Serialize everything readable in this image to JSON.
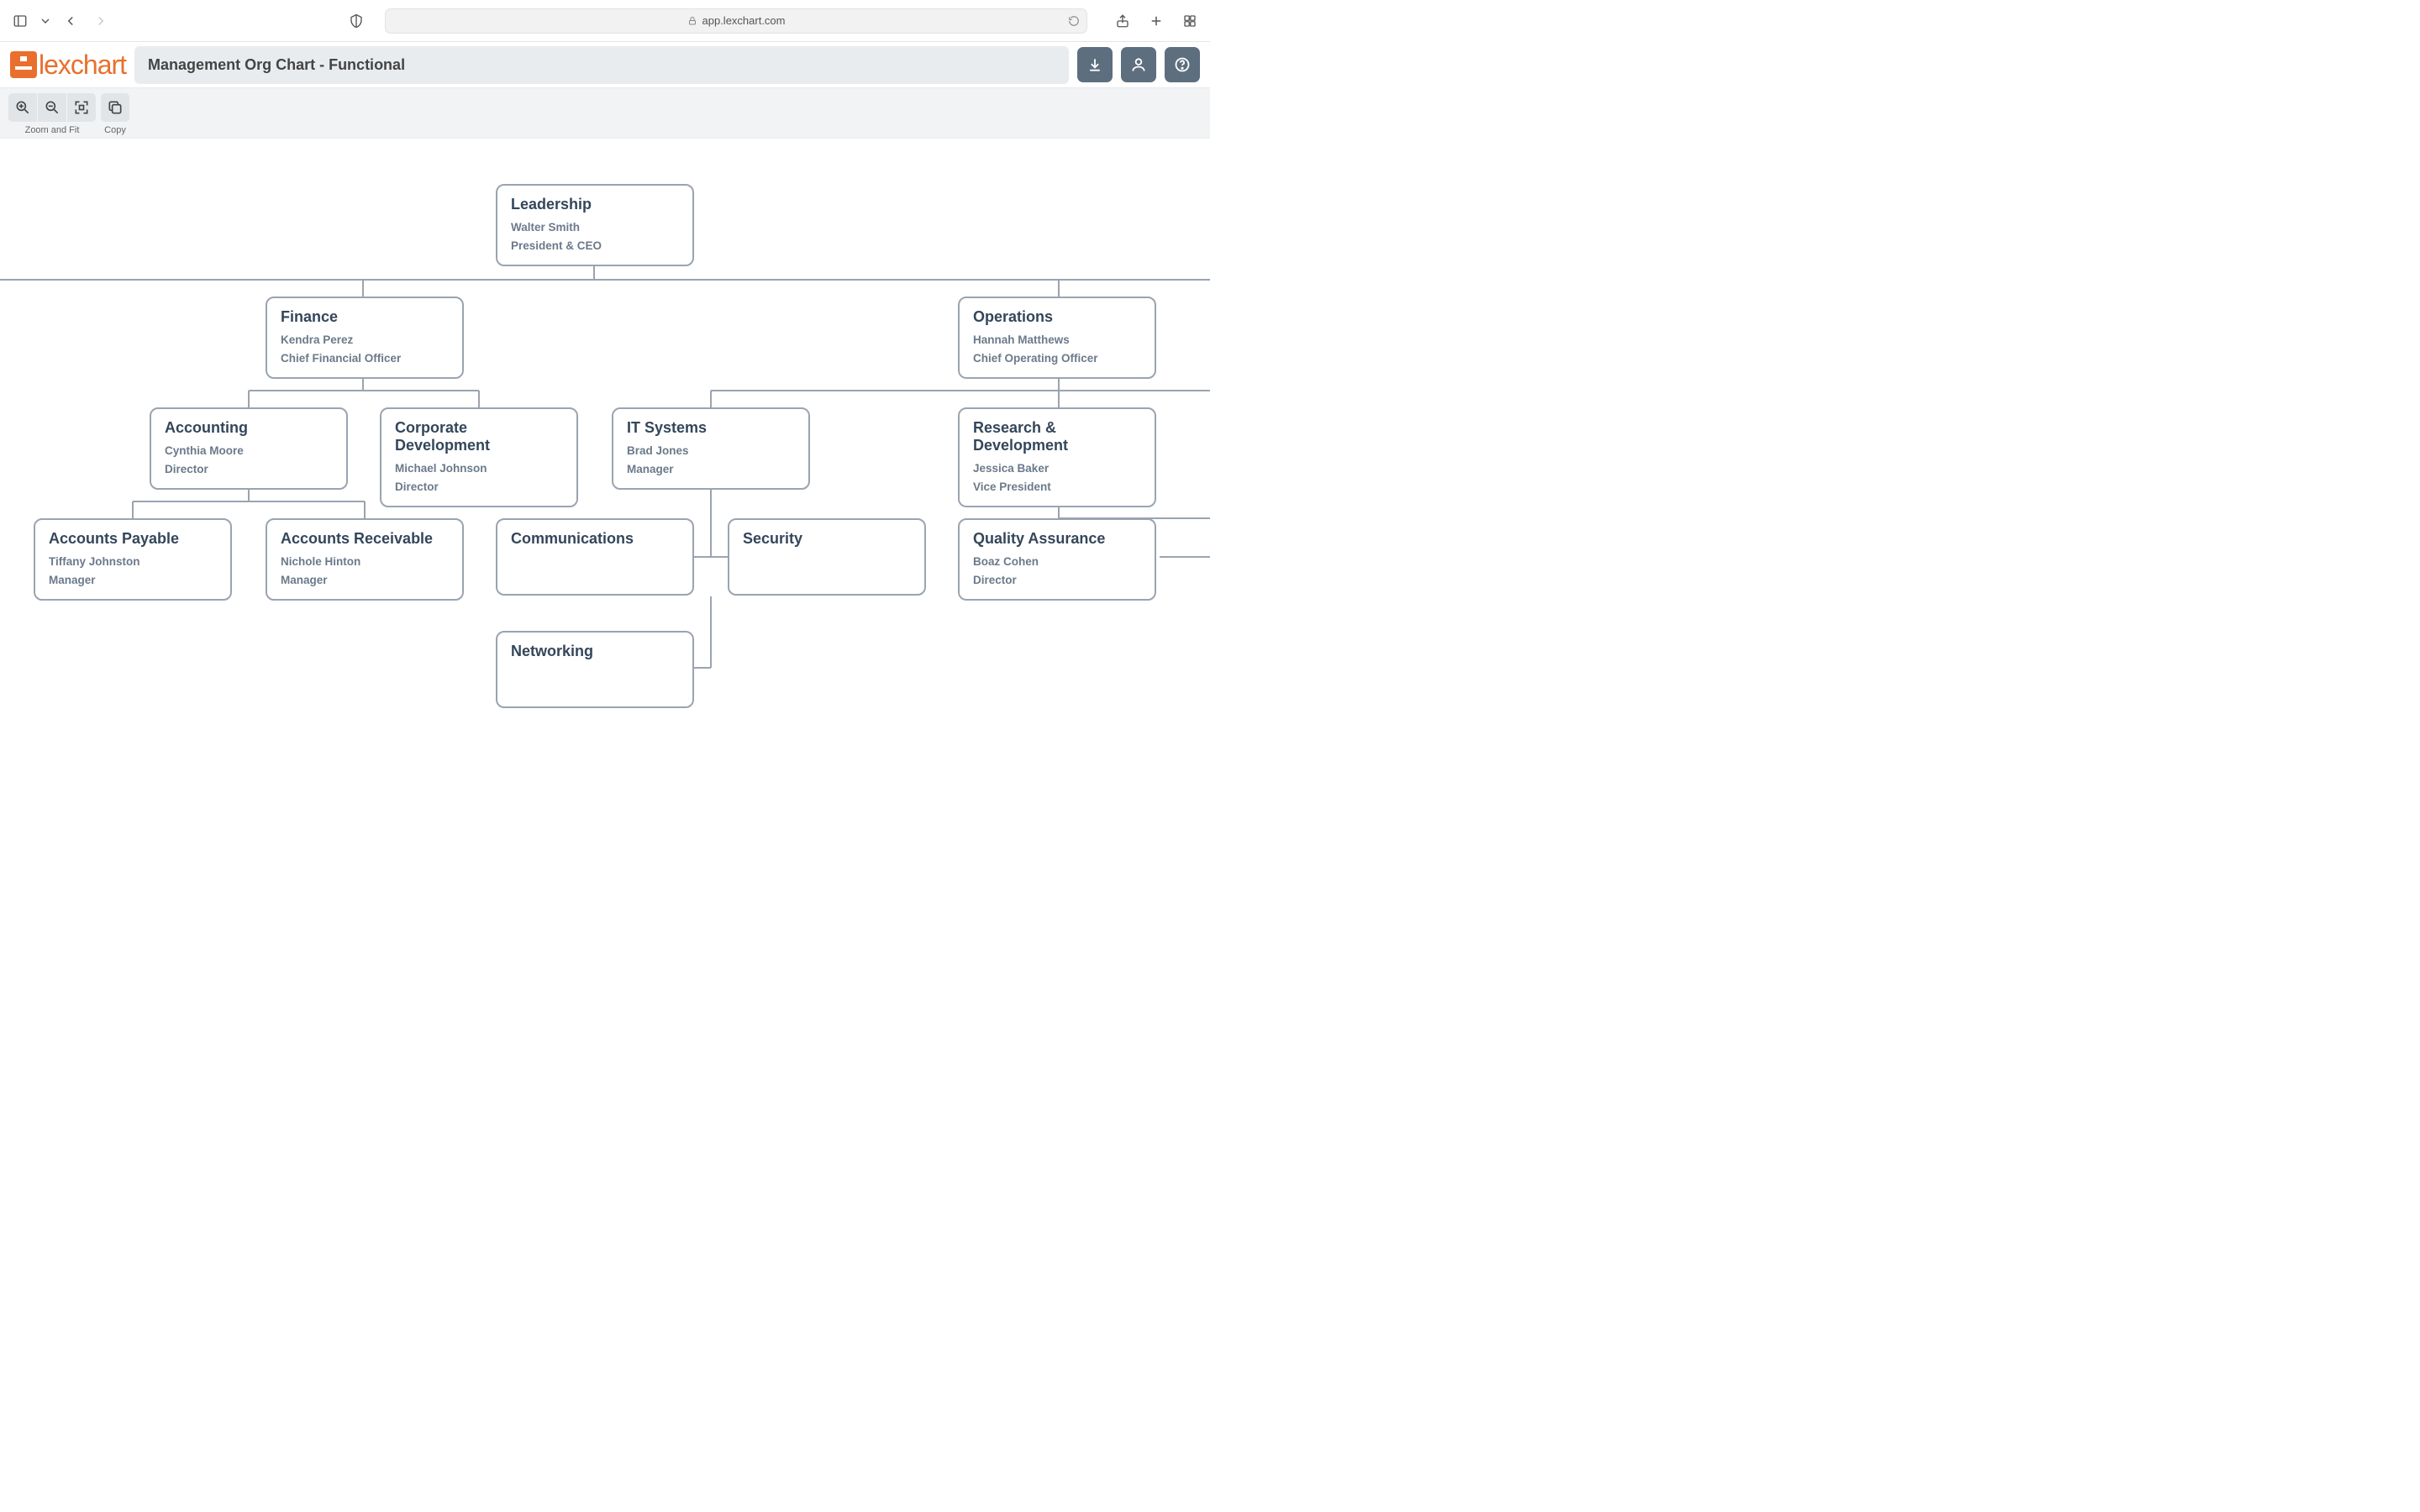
{
  "browser": {
    "url": "app.lexchart.com"
  },
  "app": {
    "brand": "lexchart",
    "document_title": "Management Org Chart - Functional"
  },
  "toolbar": {
    "zoom_group_label": "Zoom and Fit",
    "copy_group_label": "Copy"
  },
  "chart_data": {
    "type": "org-chart",
    "nodes": [
      {
        "id": "leadership",
        "title": "Leadership",
        "name": "Walter Smith",
        "role": "President & CEO",
        "parent": null
      },
      {
        "id": "finance",
        "title": "Finance",
        "name": "Kendra Perez",
        "role": "Chief Financial Officer",
        "parent": "leadership"
      },
      {
        "id": "operations",
        "title": "Operations",
        "name": "Hannah Matthews",
        "role": "Chief Operating Officer",
        "parent": "leadership"
      },
      {
        "id": "accounting",
        "title": "Accounting",
        "name": "Cynthia Moore",
        "role": "Director",
        "parent": "finance"
      },
      {
        "id": "corpdev",
        "title": "Corporate Development",
        "name": "Michael Johnson",
        "role": "Director",
        "parent": "finance"
      },
      {
        "id": "itsystems",
        "title": "IT Systems",
        "name": "Brad Jones",
        "role": "Manager",
        "parent": "operations"
      },
      {
        "id": "rnd",
        "title": "Research & Development",
        "name": "Jessica Baker",
        "role": "Vice President",
        "parent": "operations"
      },
      {
        "id": "ap",
        "title": "Accounts Payable",
        "name": "Tiffany Johnston",
        "role": "Manager",
        "parent": "accounting"
      },
      {
        "id": "ar",
        "title": "Accounts Receivable",
        "name": "Nichole Hinton",
        "role": "Manager",
        "parent": "accounting"
      },
      {
        "id": "comm",
        "title": "Communications",
        "name": "",
        "role": "",
        "parent": "itsystems"
      },
      {
        "id": "security",
        "title": "Security",
        "name": "",
        "role": "",
        "parent": "itsystems"
      },
      {
        "id": "networking",
        "title": "Networking",
        "name": "",
        "role": "",
        "parent": "itsystems"
      },
      {
        "id": "qa",
        "title": "Quality Assurance",
        "name": "Boaz Cohen",
        "role": "Director",
        "parent": "rnd"
      }
    ]
  }
}
